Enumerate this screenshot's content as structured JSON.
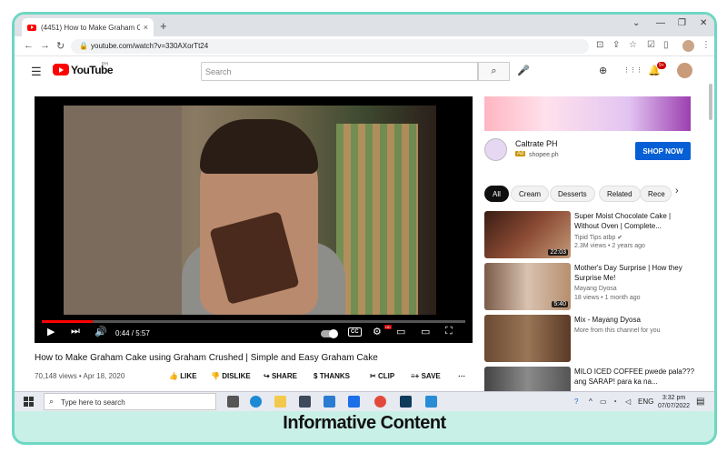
{
  "browser": {
    "tab_title": "(4451) How to Make Graham Ca",
    "tab_close": "×",
    "new_tab": "+",
    "window_controls": [
      "⌄",
      "—",
      "❐",
      "✕"
    ],
    "nav": {
      "back": "←",
      "forward": "→",
      "reload": "↻"
    },
    "url": "youtube.com/watch?v=330AXorTt24",
    "lock": "🔒"
  },
  "youtube": {
    "logo_text": "YouTube",
    "country": "PH",
    "search_placeholder": "Search",
    "search_icon": "⌕",
    "mic_icon": "🎤",
    "notifications_badge": "9+",
    "header_icons": {
      "create": "⊕",
      "apps": "⋮⋮⋮",
      "bell": "🔔"
    }
  },
  "player": {
    "current_time": "0:44 / 5:57",
    "progress": 0.12,
    "hd_badge": "HD",
    "cc_label": "CC",
    "icons": {
      "play": "▶",
      "next": "⏭",
      "volume": "🔊",
      "settings": "⚙",
      "miniplayer": "▭",
      "theater": "▭",
      "fullscreen": "⛶"
    }
  },
  "video": {
    "title": "How to Make Graham Cake using Graham Crushed | Simple and Easy Graham Cake",
    "meta": "70,148 views • Apr 18, 2020",
    "actions": [
      {
        "icon": "👍",
        "label": "LIKE"
      },
      {
        "icon": "👎",
        "label": "DISLIKE"
      },
      {
        "icon": "↪",
        "label": "SHARE"
      },
      {
        "icon": "$",
        "label": "THANKS"
      },
      {
        "icon": "✂",
        "label": "CLIP"
      },
      {
        "icon": "≡+",
        "label": "SAVE"
      },
      {
        "icon": "⋯",
        "label": ""
      }
    ]
  },
  "ad": {
    "name": "Caltrate PH",
    "tag": "Ad",
    "url": "shopee.ph",
    "button": "SHOP NOW"
  },
  "chips": [
    "All",
    "Cream",
    "Desserts",
    "Related",
    "Rece"
  ],
  "chips_next": "›",
  "recommendations": [
    {
      "title": "Super Moist Chocolate Cake | Without Oven | Complete...",
      "channel": "Tipid Tips atbp",
      "info": "2.3M views • 2 years ago",
      "duration": "22:03"
    },
    {
      "title": "Mother's Day Surprise | How they Surprise Me!",
      "channel": "Mayang Dyosa",
      "info": "18 views • 1 month ago",
      "duration": "5:40"
    },
    {
      "title": "Mix - Mayang Dyosa",
      "channel": "More from this channel for you",
      "info": "",
      "duration": ""
    },
    {
      "title": "MILO ICED COFFEE pwede pala???ang SARAP! para ka na...",
      "channel": "",
      "info": "",
      "duration": ""
    }
  ],
  "taskbar": {
    "search_placeholder": "Type here to search",
    "language": "ENG",
    "time": "3:32 pm",
    "date": "07/07/2022"
  },
  "caption": "Informative Content",
  "colors": {
    "accent": "#ff0000",
    "frame": "#6fd7c3",
    "caption_bg": "#c8f0e6",
    "shop_button": "#065fd4"
  }
}
